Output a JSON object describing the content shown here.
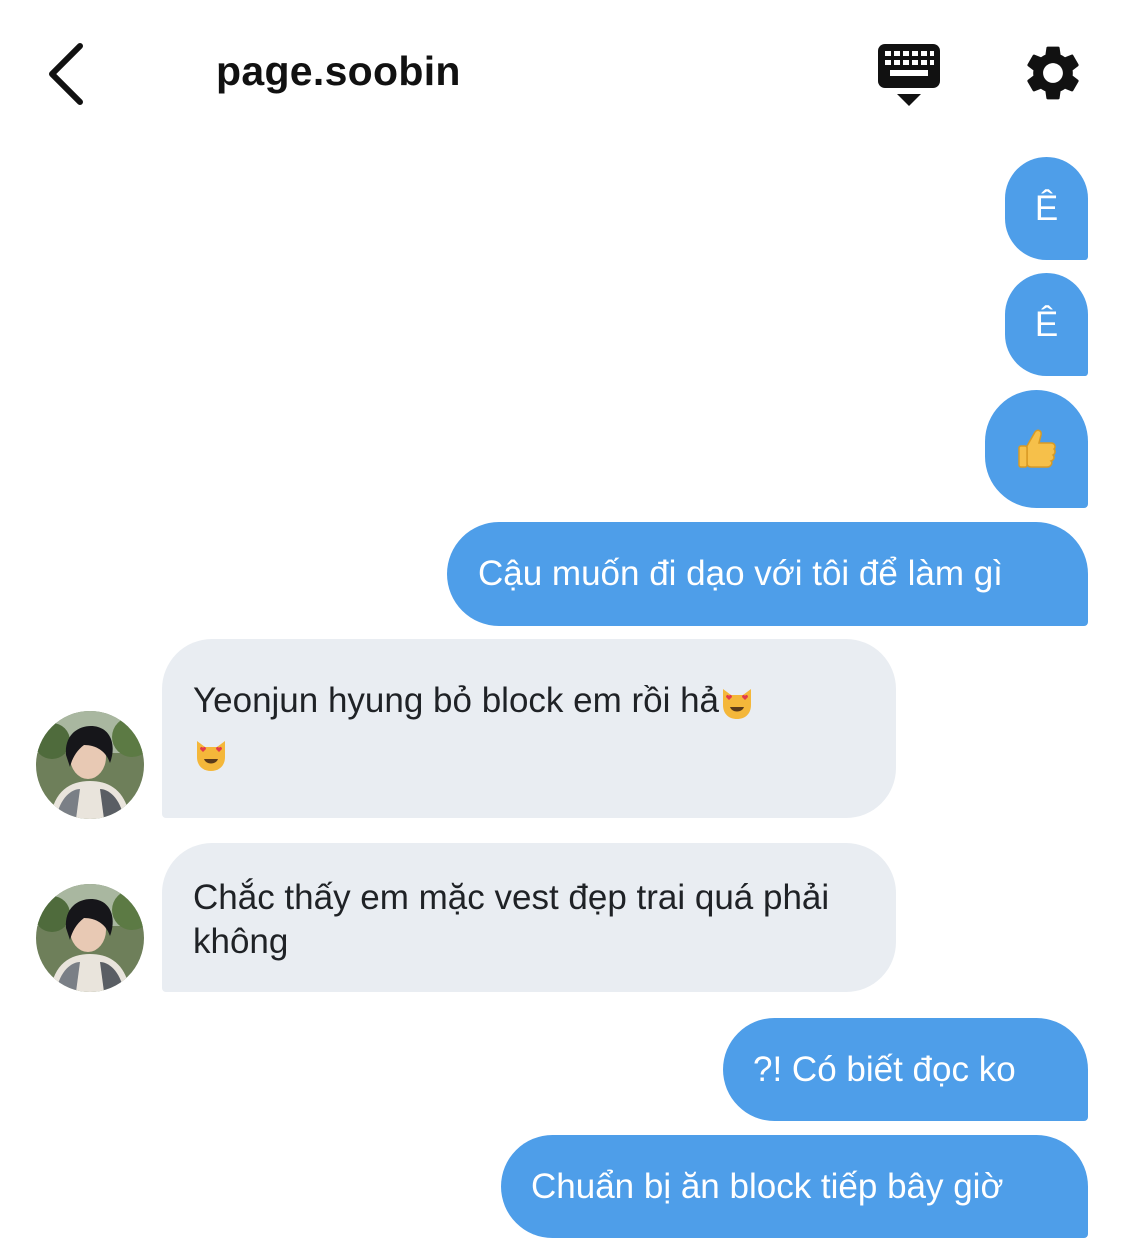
{
  "header": {
    "title": "page.soobin",
    "back_icon": "chevron-left-icon",
    "keyboard_icon": "keyboard-icon",
    "settings_icon": "gear-icon"
  },
  "colors": {
    "outgoing_bubble": "#4e9ee9",
    "incoming_bubble": "#e9edf2",
    "outgoing_text": "#ffffff",
    "incoming_text": "#1f2226"
  },
  "messages": [
    {
      "direction": "outgoing",
      "text": "Ê"
    },
    {
      "direction": "outgoing",
      "text": "Ê"
    },
    {
      "direction": "outgoing",
      "emoji": "thumbs-up-icon"
    },
    {
      "direction": "outgoing",
      "text": "Cậu muốn đi dạo với tôi để làm gì"
    },
    {
      "direction": "incoming",
      "text": "Yeonjun hyung bỏ block em rồi hả",
      "emoji": "heart-eyes-cat-icon",
      "emoji_line2": "heart-eyes-cat-icon"
    },
    {
      "direction": "incoming",
      "text": "Chắc thấy em mặc vest đẹp trai quá phải không"
    },
    {
      "direction": "outgoing",
      "text": "?! Có biết đọc ko"
    },
    {
      "direction": "outgoing",
      "text": "Chuẩn bị ăn block tiếp bây giờ"
    }
  ]
}
